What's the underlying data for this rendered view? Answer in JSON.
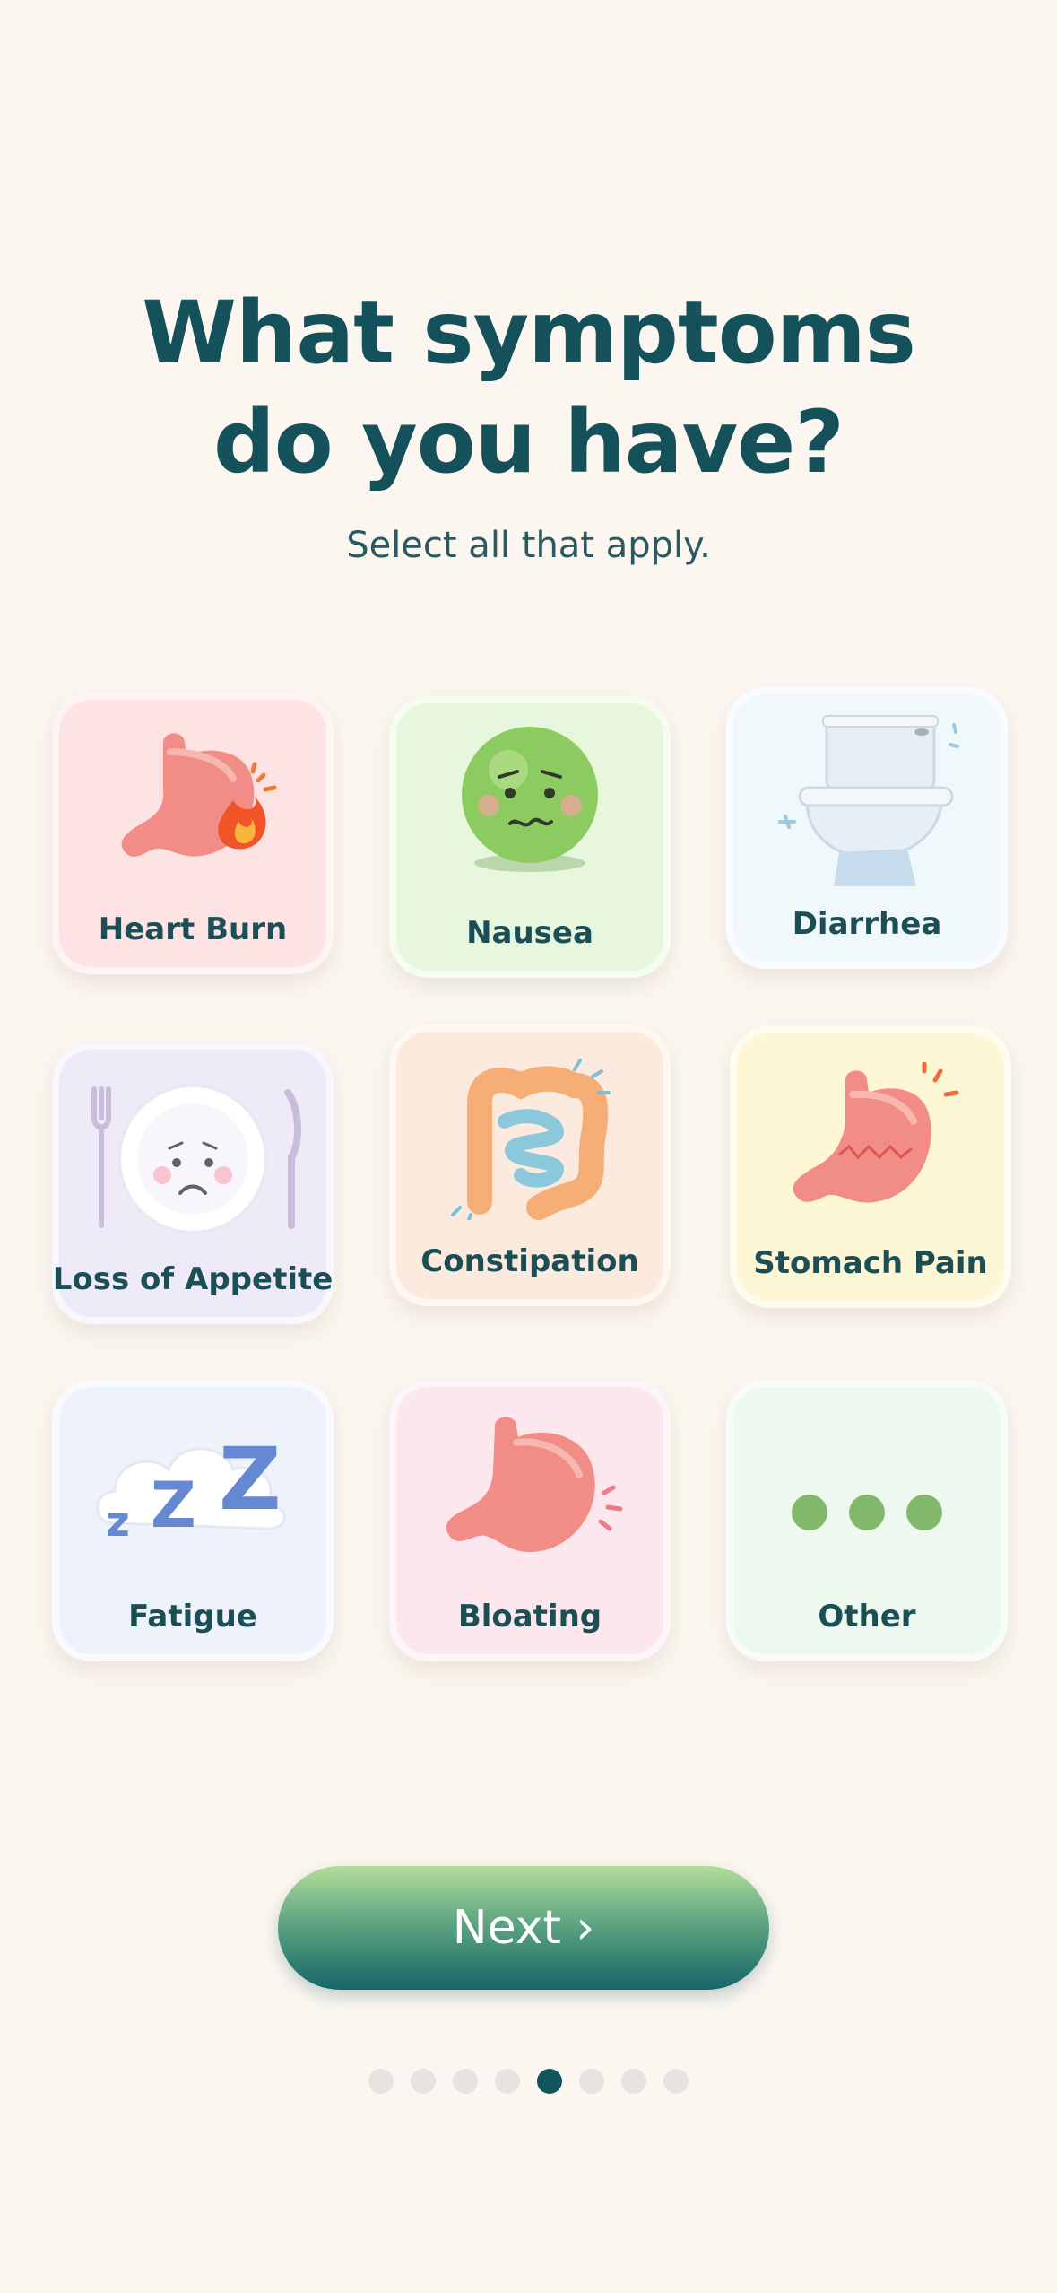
{
  "header": {
    "title_line1": "What symptoms",
    "title_line2": "do you have?",
    "subtitle": "Select all that apply."
  },
  "symptoms": [
    {
      "label": "Heart Burn",
      "icon": "stomach-fire-icon",
      "color": "#fde3e3"
    },
    {
      "label": "Nausea",
      "icon": "nauseous-face-icon",
      "color": "#e7f7dd"
    },
    {
      "label": "Diarrhea",
      "icon": "toilet-icon",
      "color": "#eef6fb"
    },
    {
      "label": "Loss of Appetite",
      "icon": "sad-plate-icon",
      "color": "#efeaf8"
    },
    {
      "label": "Constipation",
      "icon": "intestine-icon",
      "color": "#fdeadf"
    },
    {
      "label": "Stomach Pain",
      "icon": "stomach-pain-icon",
      "color": "#fdf7d6"
    },
    {
      "label": "Fatigue",
      "icon": "zzz-cloud-icon",
      "color": "#eef2fb"
    },
    {
      "label": "Bloating",
      "icon": "bloated-stomach-icon",
      "color": "#fde7ee"
    },
    {
      "label": "Other",
      "icon": "three-dots-icon",
      "color": "#edf8ee"
    }
  ],
  "next_button": {
    "label": "Next ›"
  },
  "pagination": {
    "total": 8,
    "current": 5
  }
}
